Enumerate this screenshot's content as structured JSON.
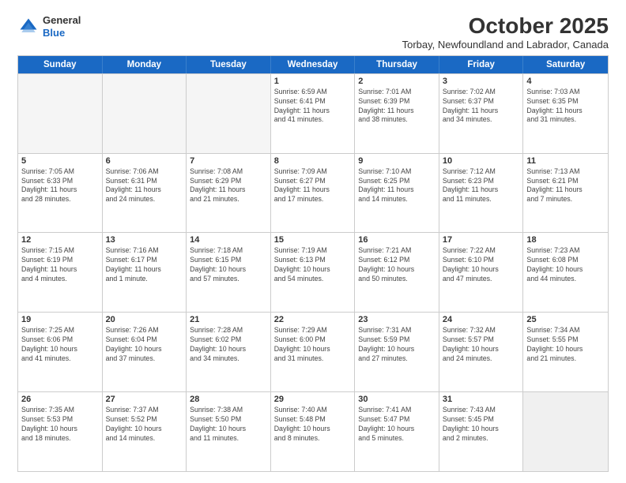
{
  "header": {
    "logo_line1": "General",
    "logo_line2": "Blue",
    "month": "October 2025",
    "location": "Torbay, Newfoundland and Labrador, Canada"
  },
  "days_of_week": [
    "Sunday",
    "Monday",
    "Tuesday",
    "Wednesday",
    "Thursday",
    "Friday",
    "Saturday"
  ],
  "weeks": [
    [
      {
        "day": "",
        "info": "",
        "empty": true
      },
      {
        "day": "",
        "info": "",
        "empty": true
      },
      {
        "day": "",
        "info": "",
        "empty": true
      },
      {
        "day": "1",
        "info": "Sunrise: 6:59 AM\nSunset: 6:41 PM\nDaylight: 11 hours\nand 41 minutes."
      },
      {
        "day": "2",
        "info": "Sunrise: 7:01 AM\nSunset: 6:39 PM\nDaylight: 11 hours\nand 38 minutes."
      },
      {
        "day": "3",
        "info": "Sunrise: 7:02 AM\nSunset: 6:37 PM\nDaylight: 11 hours\nand 34 minutes."
      },
      {
        "day": "4",
        "info": "Sunrise: 7:03 AM\nSunset: 6:35 PM\nDaylight: 11 hours\nand 31 minutes."
      }
    ],
    [
      {
        "day": "5",
        "info": "Sunrise: 7:05 AM\nSunset: 6:33 PM\nDaylight: 11 hours\nand 28 minutes."
      },
      {
        "day": "6",
        "info": "Sunrise: 7:06 AM\nSunset: 6:31 PM\nDaylight: 11 hours\nand 24 minutes."
      },
      {
        "day": "7",
        "info": "Sunrise: 7:08 AM\nSunset: 6:29 PM\nDaylight: 11 hours\nand 21 minutes."
      },
      {
        "day": "8",
        "info": "Sunrise: 7:09 AM\nSunset: 6:27 PM\nDaylight: 11 hours\nand 17 minutes."
      },
      {
        "day": "9",
        "info": "Sunrise: 7:10 AM\nSunset: 6:25 PM\nDaylight: 11 hours\nand 14 minutes."
      },
      {
        "day": "10",
        "info": "Sunrise: 7:12 AM\nSunset: 6:23 PM\nDaylight: 11 hours\nand 11 minutes."
      },
      {
        "day": "11",
        "info": "Sunrise: 7:13 AM\nSunset: 6:21 PM\nDaylight: 11 hours\nand 7 minutes."
      }
    ],
    [
      {
        "day": "12",
        "info": "Sunrise: 7:15 AM\nSunset: 6:19 PM\nDaylight: 11 hours\nand 4 minutes."
      },
      {
        "day": "13",
        "info": "Sunrise: 7:16 AM\nSunset: 6:17 PM\nDaylight: 11 hours\nand 1 minute."
      },
      {
        "day": "14",
        "info": "Sunrise: 7:18 AM\nSunset: 6:15 PM\nDaylight: 10 hours\nand 57 minutes."
      },
      {
        "day": "15",
        "info": "Sunrise: 7:19 AM\nSunset: 6:13 PM\nDaylight: 10 hours\nand 54 minutes."
      },
      {
        "day": "16",
        "info": "Sunrise: 7:21 AM\nSunset: 6:12 PM\nDaylight: 10 hours\nand 50 minutes."
      },
      {
        "day": "17",
        "info": "Sunrise: 7:22 AM\nSunset: 6:10 PM\nDaylight: 10 hours\nand 47 minutes."
      },
      {
        "day": "18",
        "info": "Sunrise: 7:23 AM\nSunset: 6:08 PM\nDaylight: 10 hours\nand 44 minutes."
      }
    ],
    [
      {
        "day": "19",
        "info": "Sunrise: 7:25 AM\nSunset: 6:06 PM\nDaylight: 10 hours\nand 41 minutes."
      },
      {
        "day": "20",
        "info": "Sunrise: 7:26 AM\nSunset: 6:04 PM\nDaylight: 10 hours\nand 37 minutes."
      },
      {
        "day": "21",
        "info": "Sunrise: 7:28 AM\nSunset: 6:02 PM\nDaylight: 10 hours\nand 34 minutes."
      },
      {
        "day": "22",
        "info": "Sunrise: 7:29 AM\nSunset: 6:00 PM\nDaylight: 10 hours\nand 31 minutes."
      },
      {
        "day": "23",
        "info": "Sunrise: 7:31 AM\nSunset: 5:59 PM\nDaylight: 10 hours\nand 27 minutes."
      },
      {
        "day": "24",
        "info": "Sunrise: 7:32 AM\nSunset: 5:57 PM\nDaylight: 10 hours\nand 24 minutes."
      },
      {
        "day": "25",
        "info": "Sunrise: 7:34 AM\nSunset: 5:55 PM\nDaylight: 10 hours\nand 21 minutes."
      }
    ],
    [
      {
        "day": "26",
        "info": "Sunrise: 7:35 AM\nSunset: 5:53 PM\nDaylight: 10 hours\nand 18 minutes."
      },
      {
        "day": "27",
        "info": "Sunrise: 7:37 AM\nSunset: 5:52 PM\nDaylight: 10 hours\nand 14 minutes."
      },
      {
        "day": "28",
        "info": "Sunrise: 7:38 AM\nSunset: 5:50 PM\nDaylight: 10 hours\nand 11 minutes."
      },
      {
        "day": "29",
        "info": "Sunrise: 7:40 AM\nSunset: 5:48 PM\nDaylight: 10 hours\nand 8 minutes."
      },
      {
        "day": "30",
        "info": "Sunrise: 7:41 AM\nSunset: 5:47 PM\nDaylight: 10 hours\nand 5 minutes."
      },
      {
        "day": "31",
        "info": "Sunrise: 7:43 AM\nSunset: 5:45 PM\nDaylight: 10 hours\nand 2 minutes."
      },
      {
        "day": "",
        "info": "",
        "empty": true,
        "shaded": true
      }
    ]
  ]
}
